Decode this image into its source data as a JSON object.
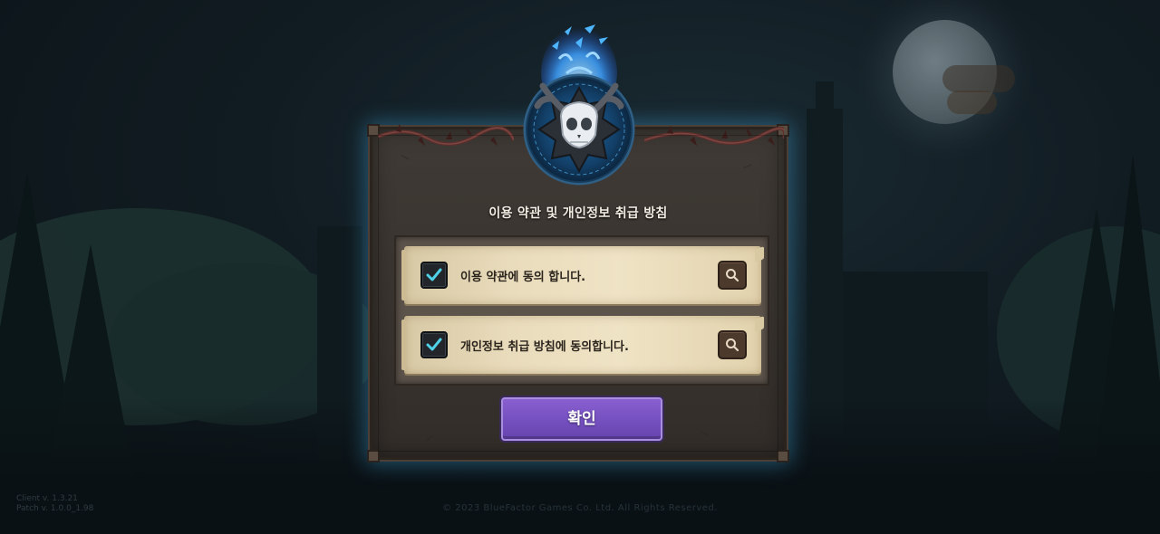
{
  "dialog": {
    "title": "이용 약관 및 개인정보 취급 방침",
    "items": [
      {
        "label": "이용 약관에 동의 합니다.",
        "checked": true
      },
      {
        "label": "개인정보 취급 방침에 동의합니다.",
        "checked": true
      }
    ],
    "confirm_label": "확인"
  },
  "footer": {
    "client_version": "Client v. 1.3.21",
    "patch_version": "Patch v. 1.0.0_1.98",
    "copyright": "© 2023 BlueFactor Games Co. Ltd. All Rights Reserved."
  },
  "colors": {
    "accent_button": "#7450bf",
    "glow": "#3c96c8",
    "checkmark": "#4fd1e8"
  }
}
